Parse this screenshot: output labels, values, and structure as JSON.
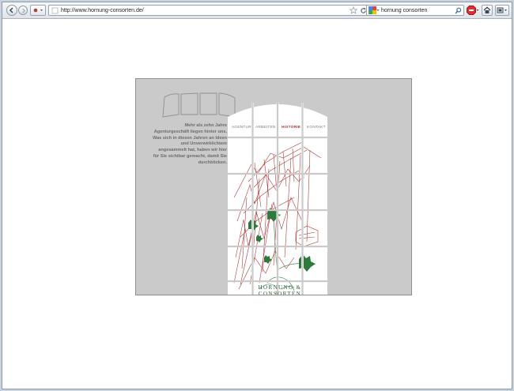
{
  "browser": {
    "url": "http://www.hornung-consorten.de/",
    "search_query": "hornung consorten",
    "icons": {
      "back": "back-arrow-icon",
      "forward": "forward-arrow-icon",
      "history": "history-dropdown-icon",
      "bookmark": "bookmark-star-icon",
      "reload": "reload-icon",
      "search_engine": "google-icon",
      "search": "magnifier-icon",
      "addon": "abp-addon-icon",
      "home": "home-icon",
      "menu": "menu-icon"
    }
  },
  "site": {
    "intro_text": "Mehr als zehn Jahre Agenturgeschäft liegen hinter uns. Was sich in diesen Jahren an Ideen und Unverwirklichtem angesammelt hat, haben wir hier für Sie sichtbar gemacht, damit Sie durchblicken.",
    "nav": [
      {
        "label": "AGENTUR",
        "active": false
      },
      {
        "label": "ARBEITEN",
        "active": false
      },
      {
        "label": "HISTORIE",
        "active": true
      },
      {
        "label": "KONTAKT",
        "active": false
      }
    ],
    "logo": "HORNUNG & CONSORTEN",
    "colors": {
      "background": "#cacaca",
      "active_nav": "#a83c3c",
      "illustration": "#b23a3a",
      "leaf_green": "#2e7a3e"
    }
  }
}
